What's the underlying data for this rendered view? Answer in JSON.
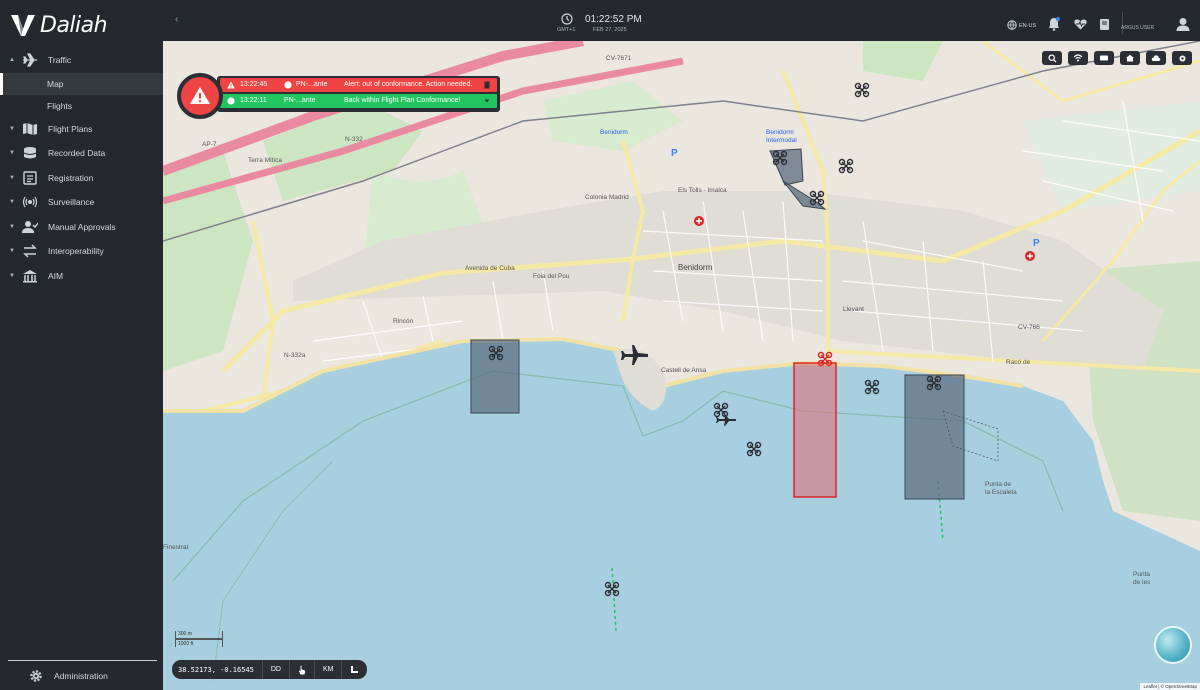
{
  "app": {
    "name": "Daliah"
  },
  "sidebar": {
    "items": [
      {
        "label": "Traffic",
        "icon": "airplane-icon",
        "expanded": true
      },
      {
        "label": "Flight Plans",
        "icon": "map-icon"
      },
      {
        "label": "Recorded Data",
        "icon": "database-icon"
      },
      {
        "label": "Registration",
        "icon": "id-card-icon"
      },
      {
        "label": "Surveillance",
        "icon": "radar-icon"
      },
      {
        "label": "Manual Approvals",
        "icon": "user-check-icon"
      },
      {
        "label": "Interoperability",
        "icon": "exchange-icon"
      },
      {
        "label": "AIM",
        "icon": "building-icon"
      }
    ],
    "sub_items": [
      {
        "label": "Map",
        "active": true
      },
      {
        "label": "Flights",
        "active": false
      }
    ],
    "admin": {
      "label": "Administration",
      "icon": "gear-icon"
    }
  },
  "topbar": {
    "time": "01:22:52 PM",
    "timezone": "GMT+1",
    "date": "FEB 27, 2025",
    "language": "EN-US",
    "user": "ARGUS USER"
  },
  "alerts": [
    {
      "time": "13:22:45",
      "id": "PN-...ante",
      "message": "Alert: out of conformance. Action needed.",
      "status": "red"
    },
    {
      "time": "13:22:11",
      "id": "PN-...ante",
      "message": "Back within Flight Plan Conformance!",
      "status": "green"
    }
  ],
  "map_labels": {
    "benidorm": "Benidorm",
    "benidorm_top": "Benidorm",
    "benidorm_intermodal": "Benidorm\nIntermodal",
    "terra_mitica": "Terra Mítica",
    "colonia_madrid": "Colonia Madrid",
    "els_tolls": "Els Tolls - Imalca",
    "foia_del_pou": "Foia del Pou",
    "rincon": "Rincón",
    "castell": "Castell de Ansa",
    "avenida_cuba": "Avenida de Cuba",
    "n332": "N-332",
    "n332a": "N-332a",
    "cv7671": "CV-7671",
    "cv766": "CV-766",
    "ap7": "AP-7",
    "finestrat": "Finestrat",
    "levante": "Llevant",
    "cala_finestrat": "Cala de Finestrat",
    "racó": "Racó de",
    "punta": "Punta de\nla Escaleta",
    "punta2": "Punta\nde les"
  },
  "bottom_bar": {
    "coords": "38.52173, -0.16545",
    "format": "DD",
    "unit": "KM"
  },
  "scale": {
    "metric": "300 m",
    "imperial": "1000 ft"
  },
  "attribution": "Leaflet | © OpenStreetMap",
  "colors": {
    "alert_red": "#ef4444",
    "ok_green": "#22c55e",
    "sidebar_bg": "#25282e",
    "sea": "#a7cfe0"
  }
}
